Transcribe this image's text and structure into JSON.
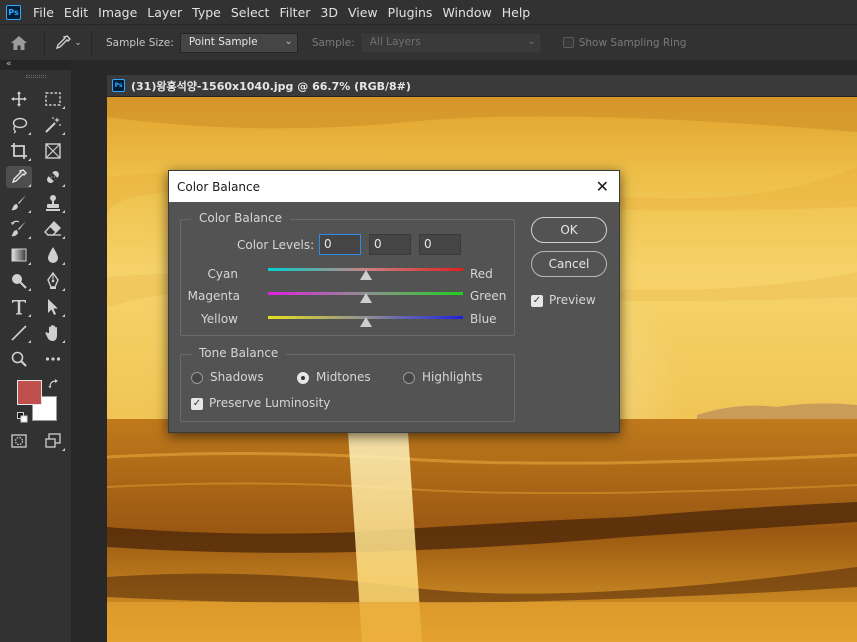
{
  "app": {
    "logo": "Ps"
  },
  "menu": [
    "File",
    "Edit",
    "Image",
    "Layer",
    "Type",
    "Select",
    "Filter",
    "3D",
    "View",
    "Plugins",
    "Window",
    "Help"
  ],
  "options": {
    "sample_size_label": "Sample Size:",
    "sample_size_value": "Point Sample",
    "sample_label": "Sample:",
    "sample_value": "All Layers",
    "sampling_ring_label": "Show Sampling Ring"
  },
  "toolbar": {
    "collapse": "«",
    "tools": [
      "move-icon",
      "marquee-icon",
      "lasso-icon",
      "magic-wand-icon",
      "crop-icon",
      "frame-icon",
      "eyedropper-icon",
      "healing-icon",
      "brush-icon",
      "stamp-icon",
      "history-brush-icon",
      "eraser-icon",
      "gradient-icon",
      "blur-icon",
      "dodge-icon",
      "pen-icon",
      "type-icon",
      "path-select-icon",
      "line-icon",
      "hand-icon",
      "zoom-icon",
      "more-icon"
    ],
    "active_tool": "eyedropper-icon",
    "foreground_color": "#c0504d",
    "background_color": "#ffffff"
  },
  "document": {
    "tab_title": "(31)왕홍석양-1560x1040.jpg @ 66.7% (RGB/8#)"
  },
  "dialog": {
    "title": "Color Balance",
    "color_balance_group": "Color Balance",
    "color_levels_label": "Color Levels:",
    "levels": [
      "0",
      "0",
      "0"
    ],
    "sliders": [
      {
        "left": "Cyan",
        "right": "Red",
        "value": 0
      },
      {
        "left": "Magenta",
        "right": "Green",
        "value": 0
      },
      {
        "left": "Yellow",
        "right": "Blue",
        "value": 0
      }
    ],
    "tone_group": "Tone Balance",
    "tones": [
      {
        "label": "Shadows",
        "selected": false
      },
      {
        "label": "Midtones",
        "selected": true
      },
      {
        "label": "Highlights",
        "selected": false
      }
    ],
    "preserve_luminosity": "Preserve Luminosity",
    "ok": "OK",
    "cancel": "Cancel",
    "preview": "Preview"
  }
}
